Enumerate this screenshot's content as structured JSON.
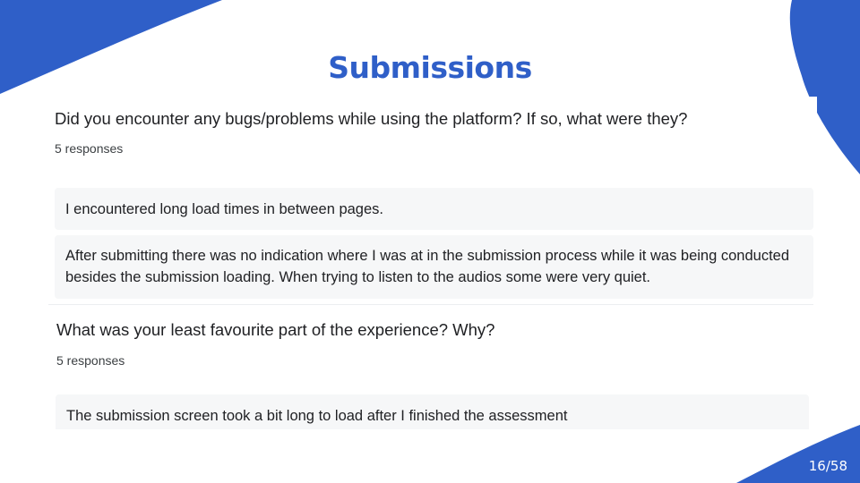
{
  "slide": {
    "title": "Submissions",
    "page_number": "16/58",
    "accent_color": "#2f5fc8"
  },
  "questions": [
    {
      "text": "Did you encounter any bugs/problems while using the platform? If so, what were they?",
      "count": "5 responses",
      "responses": [
        "I encountered long load times in between pages.",
        "After submitting there was no indication where I was at in the submission process while it was being conducted besides the submission loading. When trying to listen to the audios some were very quiet."
      ]
    },
    {
      "text": "What was your least favourite part of the experience? Why?",
      "count": "5 responses",
      "responses": [
        "The submission screen took a bit long to load after I finished the assessment"
      ]
    }
  ]
}
